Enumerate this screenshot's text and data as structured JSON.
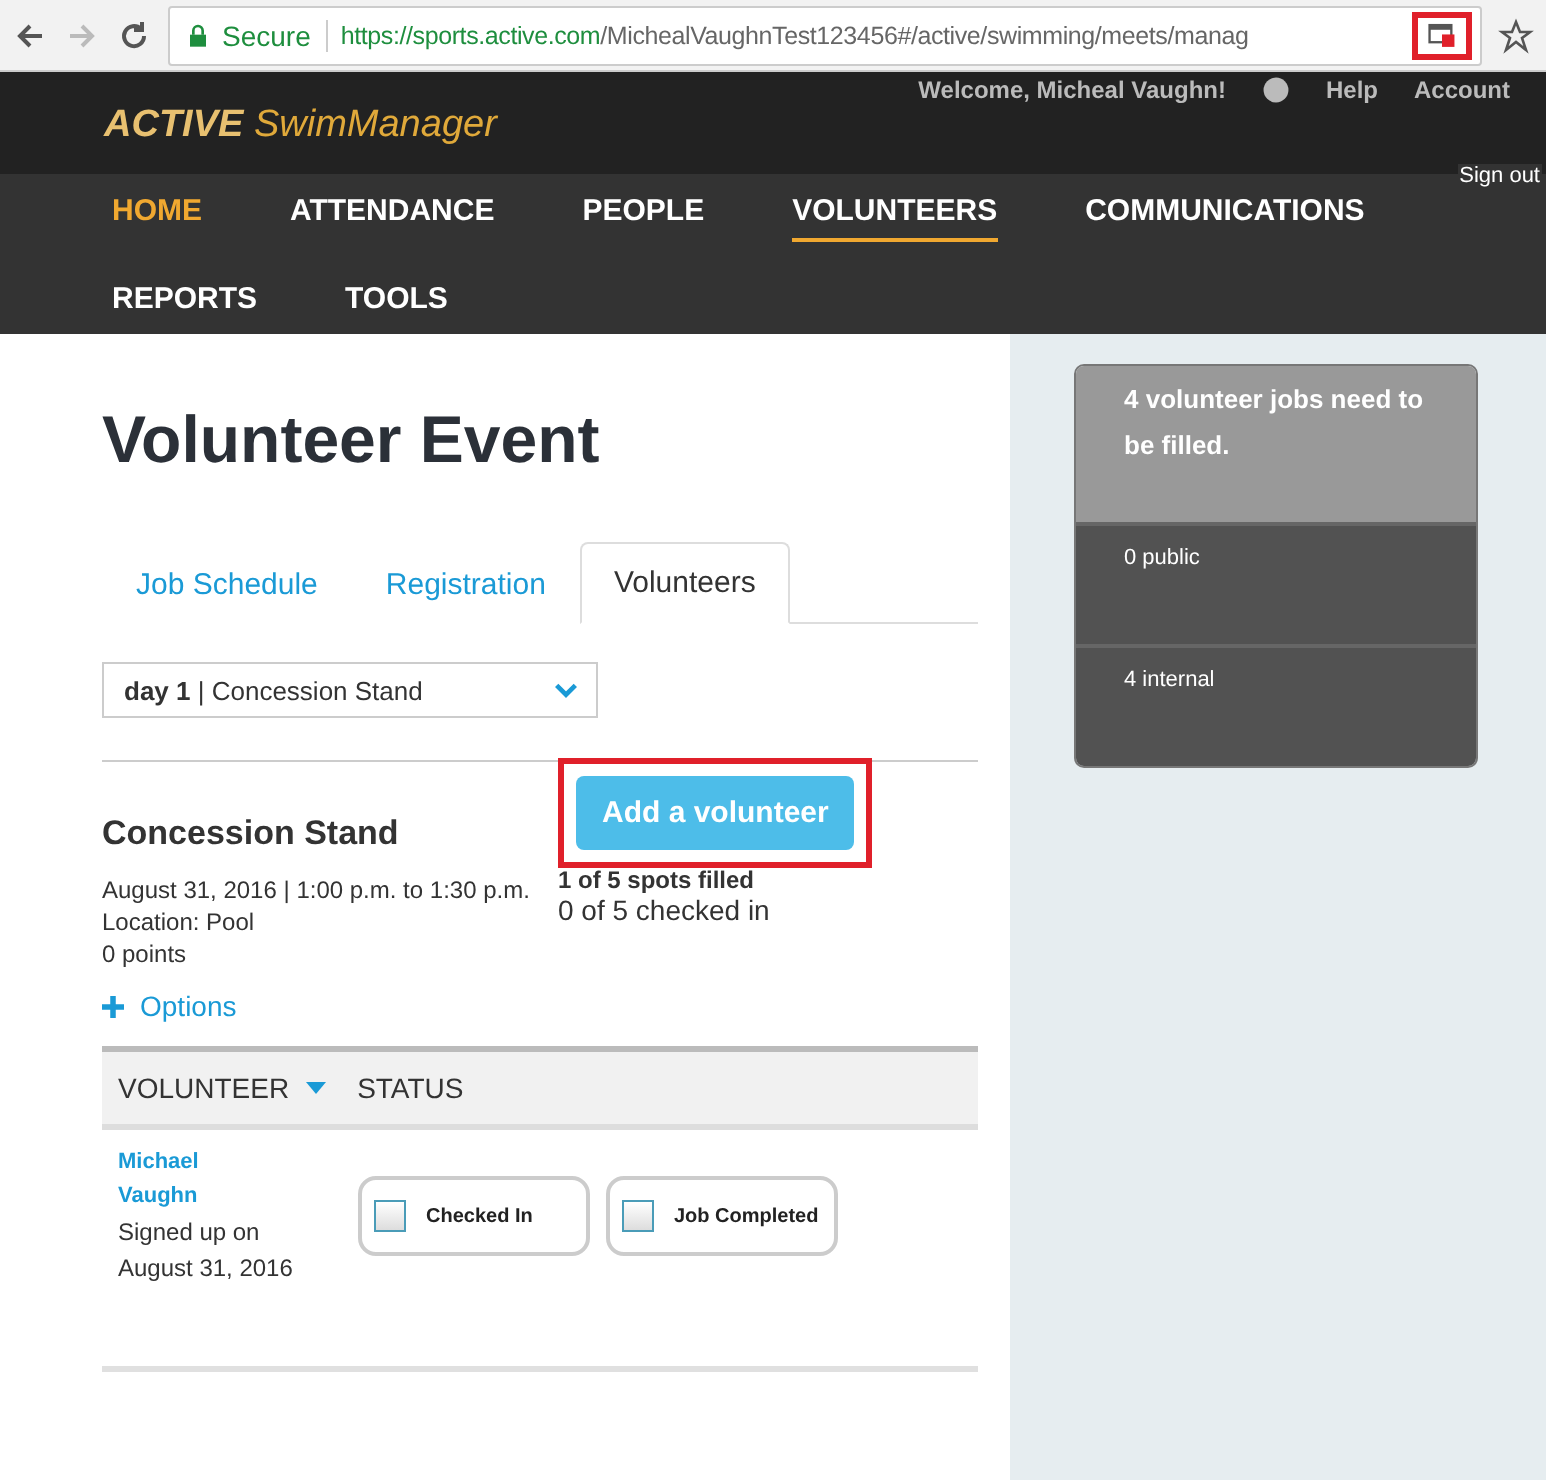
{
  "browser": {
    "secure_label": "Secure",
    "url_host": "https://sports.active.com",
    "url_path": "/MichealVaughnTest123456#/active/swimming/meets/manag"
  },
  "header": {
    "logo_bold": "ACTIVE",
    "logo_light": "SwimManager",
    "welcome": "Welcome, Micheal Vaughn!",
    "links": [
      "Help",
      "Account"
    ],
    "sign_out": "Sign out"
  },
  "nav": [
    {
      "label": "HOME",
      "highlighted": true,
      "selected": false
    },
    {
      "label": "ATTENDANCE",
      "highlighted": false,
      "selected": false
    },
    {
      "label": "PEOPLE",
      "highlighted": false,
      "selected": false
    },
    {
      "label": "VOLUNTEERS",
      "highlighted": false,
      "selected": true
    },
    {
      "label": "COMMUNICATIONS",
      "highlighted": false,
      "selected": false
    },
    {
      "label": "REPORTS",
      "highlighted": false,
      "selected": false
    },
    {
      "label": "TOOLS",
      "highlighted": false,
      "selected": false
    }
  ],
  "page_title": "Volunteer Event",
  "tabs": [
    {
      "label": "Job Schedule",
      "selected": false
    },
    {
      "label": "Registration",
      "selected": false
    },
    {
      "label": "Volunteers",
      "selected": true
    }
  ],
  "job_select": {
    "value": "**day 1** | Concession Stand"
  },
  "job": {
    "title": "Concession Stand",
    "date": "August 31, 2016 | 1:00 p.m. to 1:30 p.m.",
    "location": "Location: Pool",
    "points": "0 points",
    "options": "Options",
    "add_button": "Add a volunteer",
    "spots": "1 of 5 spots filled",
    "checked_in": "0 of 5 checked in"
  },
  "table": {
    "columns": [
      "VOLUNTEER",
      "STATUS"
    ],
    "rows": [
      {
        "name": "Michael Vaughn",
        "signed_up": "Signed up on August 31, 2016",
        "statuses": [
          {
            "label": "Checked In",
            "checked": false
          },
          {
            "label": "Job Completed",
            "checked": false
          }
        ]
      }
    ]
  },
  "summary": {
    "headline": "4 volunteer jobs need to be filled.",
    "items": [
      "0 public",
      "4 internal"
    ]
  }
}
